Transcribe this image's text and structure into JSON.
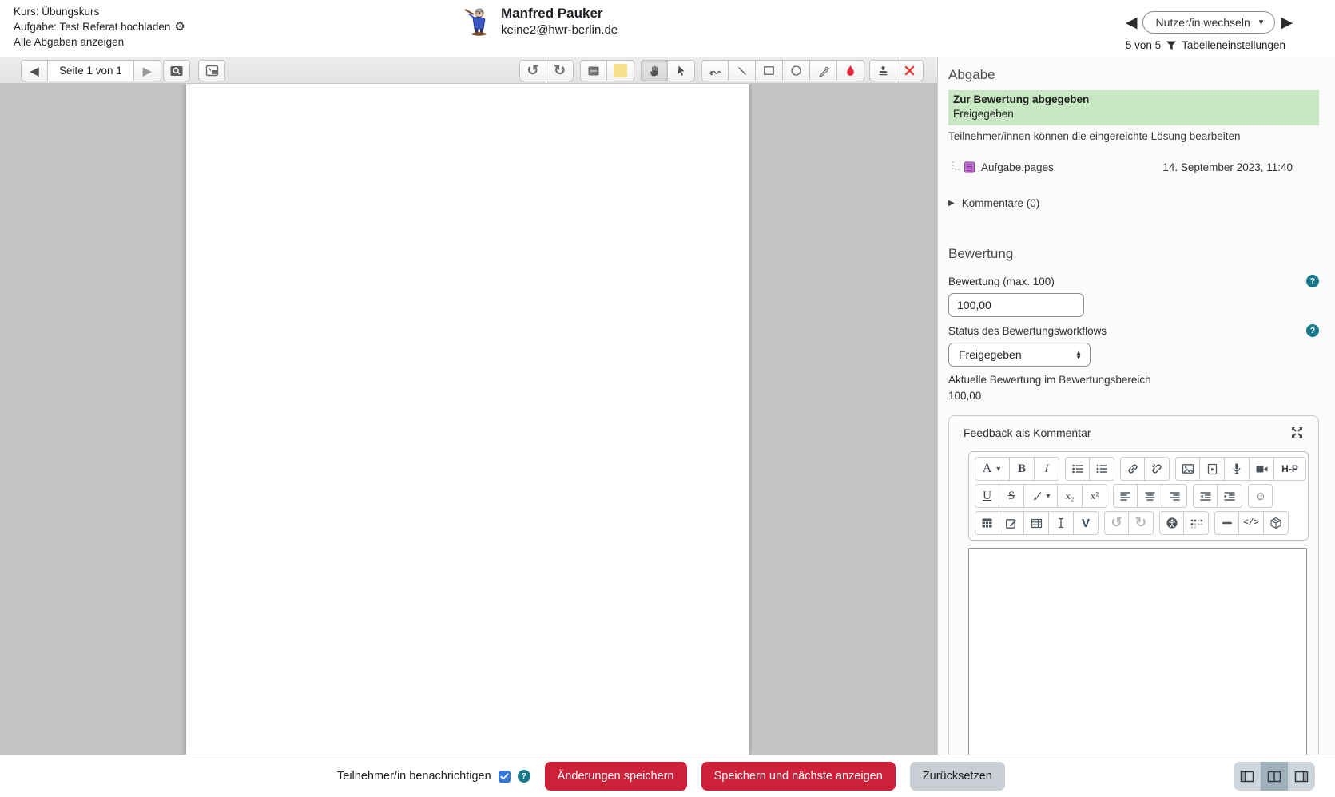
{
  "header": {
    "course": "Kurs: Übungskurs",
    "assignment": "Aufgabe: Test Referat hochladen",
    "view_all": "Alle Abgaben anzeigen",
    "user": {
      "name": "Manfred Pauker",
      "email": "keine2@hwr-berlin.de"
    },
    "user_select_label": "Nutzer/in wechseln",
    "pagination": "5 von 5",
    "table_settings": "Tabelleneinstellungen"
  },
  "pdf_toolbar": {
    "page_label": "Seite 1 von 1"
  },
  "submission": {
    "title": "Abgabe",
    "status_line1": "Zur Bewertung abgegeben",
    "status_line2": "Freigegeben",
    "edit_note": "Teilnehmer/innen können die eingereichte Lösung bearbeiten",
    "file": {
      "name": "Aufgabe.pages",
      "date": "14. September 2023, 11:40"
    },
    "comments_label": "Kommentare (0)"
  },
  "grading": {
    "title": "Bewertung",
    "grade_label": "Bewertung (max. 100)",
    "grade_value": "100,00",
    "workflow_label": "Status des Bewertungsworkflows",
    "workflow_value": "Freigegeben",
    "current_label": "Aktuelle Bewertung im Bewertungsbereich",
    "current_value": "100,00",
    "feedback_title": "Feedback als Kommentar",
    "feedback_text": ""
  },
  "editor": {
    "glyphs": {
      "style": "A",
      "bold": "B",
      "italic": "I",
      "underline": "U",
      "strike": "S",
      "sub": "x₂",
      "sup": "x²",
      "h5p": "H-P",
      "wiris": "V",
      "code": "</>",
      "undo": "↺",
      "redo": "↻",
      "emoji": "☺"
    }
  },
  "footer": {
    "notify_label": "Teilnehmer/in benachrichtigen",
    "notify_checked": true,
    "save": "Änderungen speichern",
    "save_next": "Speichern und nächste anzeigen",
    "reset": "Zurücksetzen"
  },
  "colors": {
    "accent_red": "#ce2038",
    "help_teal": "#19798c",
    "status_green_bg": "#c8e8c3",
    "checkbox_blue": "#3478d6",
    "highlight_yellow": "#f6e08e",
    "file_icon_purple": "#b55fc5",
    "canvas_gray": "#c4c4c4"
  }
}
